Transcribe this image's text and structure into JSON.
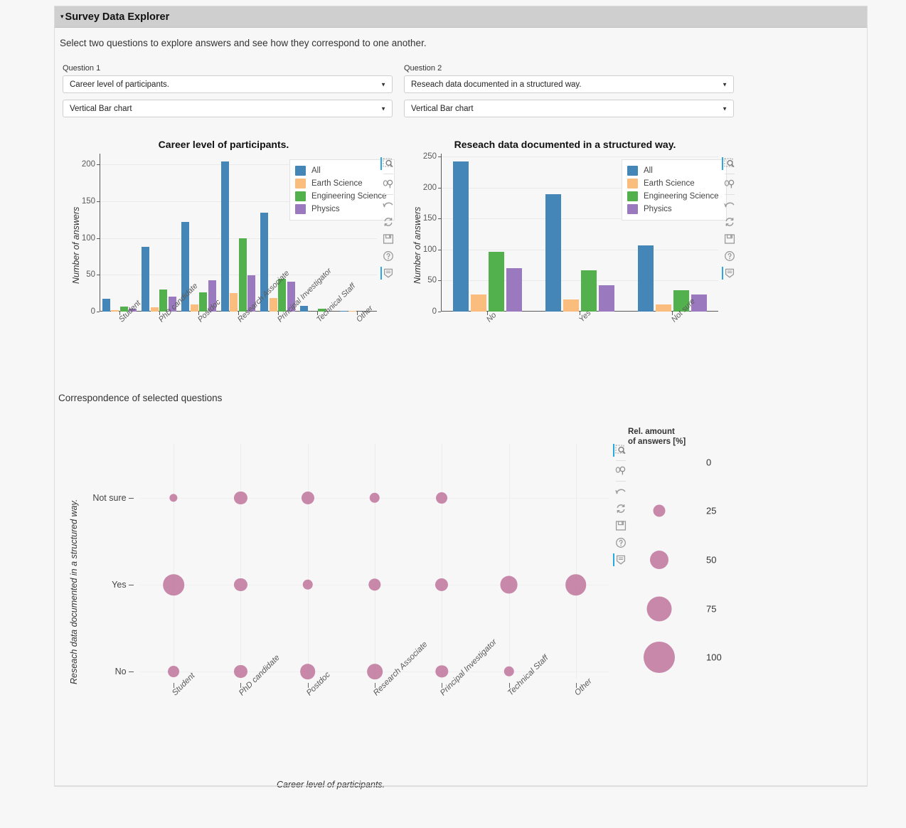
{
  "panel": {
    "title": "Survey Data Explorer",
    "caret": "▾",
    "intro": "Select two questions to explore answers and see how they correspond to one another."
  },
  "selectors": {
    "q1": {
      "label": "Question 1",
      "question_value": "Career level of participants.",
      "chart_value": "Vertical Bar chart",
      "arrow": "▼"
    },
    "q2": {
      "label": "Question 2",
      "question_value": "Reseach data documented in a structured way.",
      "chart_value": "Vertical Bar chart",
      "arrow": "▼"
    }
  },
  "toolbar": {
    "items": [
      {
        "name": "box-zoom-icon",
        "label": "Box Zoom"
      },
      {
        "name": "wheel-zoom-icon",
        "label": "Wheel Zoom"
      },
      {
        "name": "undo-icon",
        "label": "Undo"
      },
      {
        "name": "reset-icon",
        "label": "Reset"
      },
      {
        "name": "save-icon",
        "label": "Save"
      },
      {
        "name": "help-icon",
        "label": "Help"
      },
      {
        "name": "hover-icon",
        "label": "Hover"
      }
    ]
  },
  "correspondence": {
    "heading": "Correspondence of selected questions",
    "size_legend_title_line1": "Rel. amount",
    "size_legend_title_line2": "of answers [%]",
    "size_legend_values": [
      "0",
      "25",
      "50",
      "75",
      "100"
    ]
  },
  "colors": {
    "all": "#4586b8",
    "earth_science": "#fbbd7e",
    "engineering_science": "#52b14c",
    "physics": "#9a79be",
    "bubble": "#c0749b",
    "panel_header": "#cfcfcf",
    "background": "#f7f7f7"
  },
  "chart_data": [
    {
      "type": "bar",
      "title": "Career level of participants.",
      "xlabel": "",
      "ylabel": "Number of answers",
      "ylim": [
        0,
        215
      ],
      "yticks": [
        0,
        50,
        100,
        150,
        200
      ],
      "grid": true,
      "legend_position": "top-right",
      "categories": [
        "Student",
        "PhD candidate",
        "Postdoc",
        "Research Associate",
        "Principal Investigator",
        "Technical Staff",
        "Other"
      ],
      "series": [
        {
          "name": "All",
          "values": [
            17,
            88,
            122,
            204,
            135,
            8,
            1
          ]
        },
        {
          "name": "Earth Science",
          "values": [
            2,
            6,
            10,
            25,
            18,
            0,
            1
          ]
        },
        {
          "name": "Engineering Science",
          "values": [
            7,
            30,
            26,
            100,
            45,
            4,
            0
          ]
        },
        {
          "name": "Physics",
          "values": [
            4,
            20,
            43,
            49,
            41,
            0,
            0
          ]
        }
      ]
    },
    {
      "type": "bar",
      "title": "Reseach data documented in a structured way.",
      "xlabel": "",
      "ylabel": "Number of answers",
      "ylim": [
        0,
        255
      ],
      "yticks": [
        0,
        50,
        100,
        150,
        200,
        250
      ],
      "grid": true,
      "legend_position": "top-right",
      "categories": [
        "No",
        "Yes",
        "Not sure"
      ],
      "series": [
        {
          "name": "All",
          "values": [
            242,
            190,
            107
          ]
        },
        {
          "name": "Earth Science",
          "values": [
            28,
            20,
            12
          ]
        },
        {
          "name": "Engineering Science",
          "values": [
            96,
            67,
            35
          ]
        },
        {
          "name": "Physics",
          "values": [
            70,
            42,
            28
          ]
        }
      ]
    },
    {
      "type": "scatter",
      "title": "Correspondence of selected questions",
      "xlabel": "Career level of participants.",
      "ylabel": "Reseach data documented in a structured way.",
      "size_unit": "Rel. amount of answers [%]",
      "size_scale": [
        0,
        25,
        50,
        75,
        100
      ],
      "x_categories": [
        "Student",
        "PhD candidate",
        "Postdoc",
        "Research Associate",
        "Principal Investigator",
        "Technical Staff",
        "Other"
      ],
      "y_categories": [
        "No",
        "Yes",
        "Not sure"
      ],
      "points": [
        {
          "x": "Student",
          "y": "Not sure",
          "value": 9
        },
        {
          "x": "PhD candidate",
          "y": "Not sure",
          "value": 28
        },
        {
          "x": "Postdoc",
          "y": "Not sure",
          "value": 28
        },
        {
          "x": "Research Associate",
          "y": "Not sure",
          "value": 18
        },
        {
          "x": "Principal Investigator",
          "y": "Not sure",
          "value": 22
        },
        {
          "x": "Technical Staff",
          "y": "Not sure",
          "value": 0
        },
        {
          "x": "Other",
          "y": "Not sure",
          "value": 0
        },
        {
          "x": "Student",
          "y": "Yes",
          "value": 60
        },
        {
          "x": "PhD candidate",
          "y": "Yes",
          "value": 28
        },
        {
          "x": "Postdoc",
          "y": "Yes",
          "value": 18
        },
        {
          "x": "Research Associate",
          "y": "Yes",
          "value": 26
        },
        {
          "x": "Principal Investigator",
          "y": "Yes",
          "value": 28
        },
        {
          "x": "Technical Staff",
          "y": "Yes",
          "value": 47
        },
        {
          "x": "Other",
          "y": "Yes",
          "value": 60
        },
        {
          "x": "Student",
          "y": "No",
          "value": 22
        },
        {
          "x": "PhD candidate",
          "y": "No",
          "value": 28
        },
        {
          "x": "Postdoc",
          "y": "No",
          "value": 38
        },
        {
          "x": "Research Associate",
          "y": "No",
          "value": 38
        },
        {
          "x": "Principal Investigator",
          "y": "No",
          "value": 26
        },
        {
          "x": "Technical Staff",
          "y": "No",
          "value": 18
        },
        {
          "x": "Other",
          "y": "No",
          "value": 0
        }
      ]
    }
  ]
}
